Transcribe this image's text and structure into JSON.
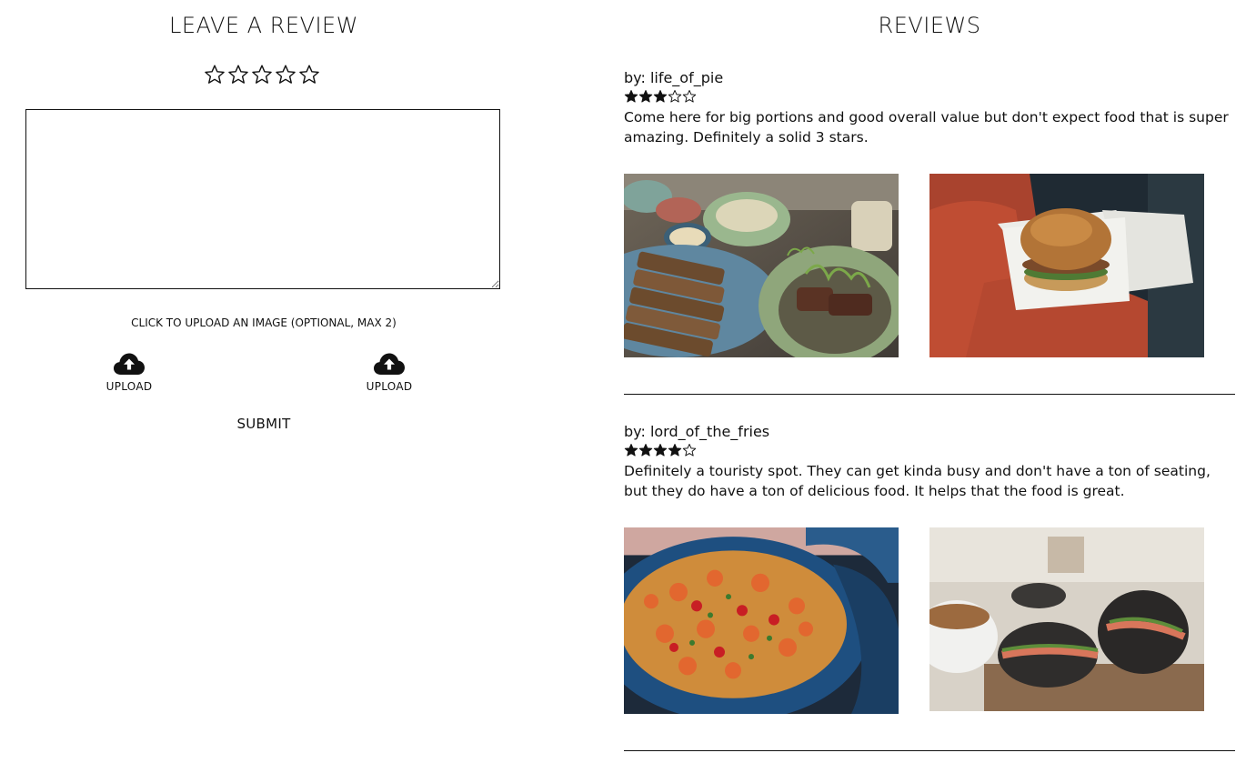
{
  "leave_review": {
    "title": "LEAVE A REVIEW",
    "rating_stars": 5,
    "upload_hint": "CLICK TO UPLOAD AN IMAGE (OPTIONAL, MAX 2)",
    "upload_buttons": [
      {
        "label": "UPLOAD",
        "icon": "cloud-upload-icon"
      },
      {
        "label": "UPLOAD",
        "icon": "cloud-upload-icon"
      }
    ],
    "submit_label": "SUBMIT"
  },
  "reviews": {
    "title": "REVIEWS",
    "items": [
      {
        "author": "by: life_of_pie",
        "rating": 3,
        "max_rating": 5,
        "text": "Come here for big portions and good overall value but don't expect food that is super amazing. Definitely a solid 3 stars.",
        "photos": [
          "bread-and-steak-photo",
          "burger-in-box-photo"
        ]
      },
      {
        "author": "by: lord_of_the_fries",
        "rating": 4,
        "max_rating": 5,
        "text": "Definitely a touristy spot. They can get kinda busy and don't have a ton of seating, but they do have a ton of delicious food. It helps that the food is great.",
        "photos": [
          "paella-photo",
          "black-bun-burger-photo"
        ]
      }
    ]
  },
  "colors": {
    "text": "#111111",
    "background": "#ffffff",
    "divider": "#111111"
  }
}
